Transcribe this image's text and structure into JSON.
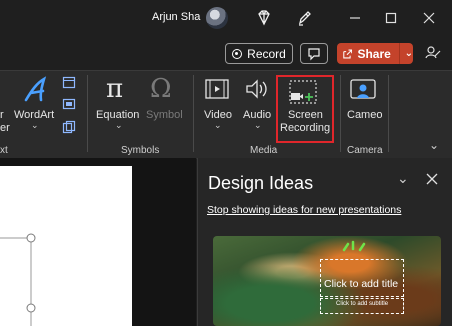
{
  "titlebar": {
    "user_name": "Arjun Sha",
    "icons": [
      "avatar",
      "diamond-icon",
      "pen-icon",
      "minimize-icon",
      "maximize-icon",
      "close-icon"
    ]
  },
  "actions": {
    "record_label": "Record",
    "share_label": "Share",
    "accent_color": "#c4432b"
  },
  "ribbon": {
    "partial_left_label": "r",
    "partial_left_label2": "er",
    "wordart_label": "WordArt",
    "equation_label": "Equation",
    "symbol_label": "Symbol",
    "video_label": "Video",
    "audio_label": "Audio",
    "screen_recording_line1": "Screen",
    "screen_recording_line2": "Recording",
    "cameo_label": "Cameo",
    "groups": {
      "text_partial": "xt",
      "symbols": "Symbols",
      "media": "Media",
      "camera": "Camera"
    },
    "highlight_color": "#e0262b"
  },
  "design_pane": {
    "title": "Design Ideas",
    "link": "Stop showing ideas for new presentations",
    "thumb_title": "Click to add title",
    "thumb_subtitle": "Click to add subtitle"
  }
}
